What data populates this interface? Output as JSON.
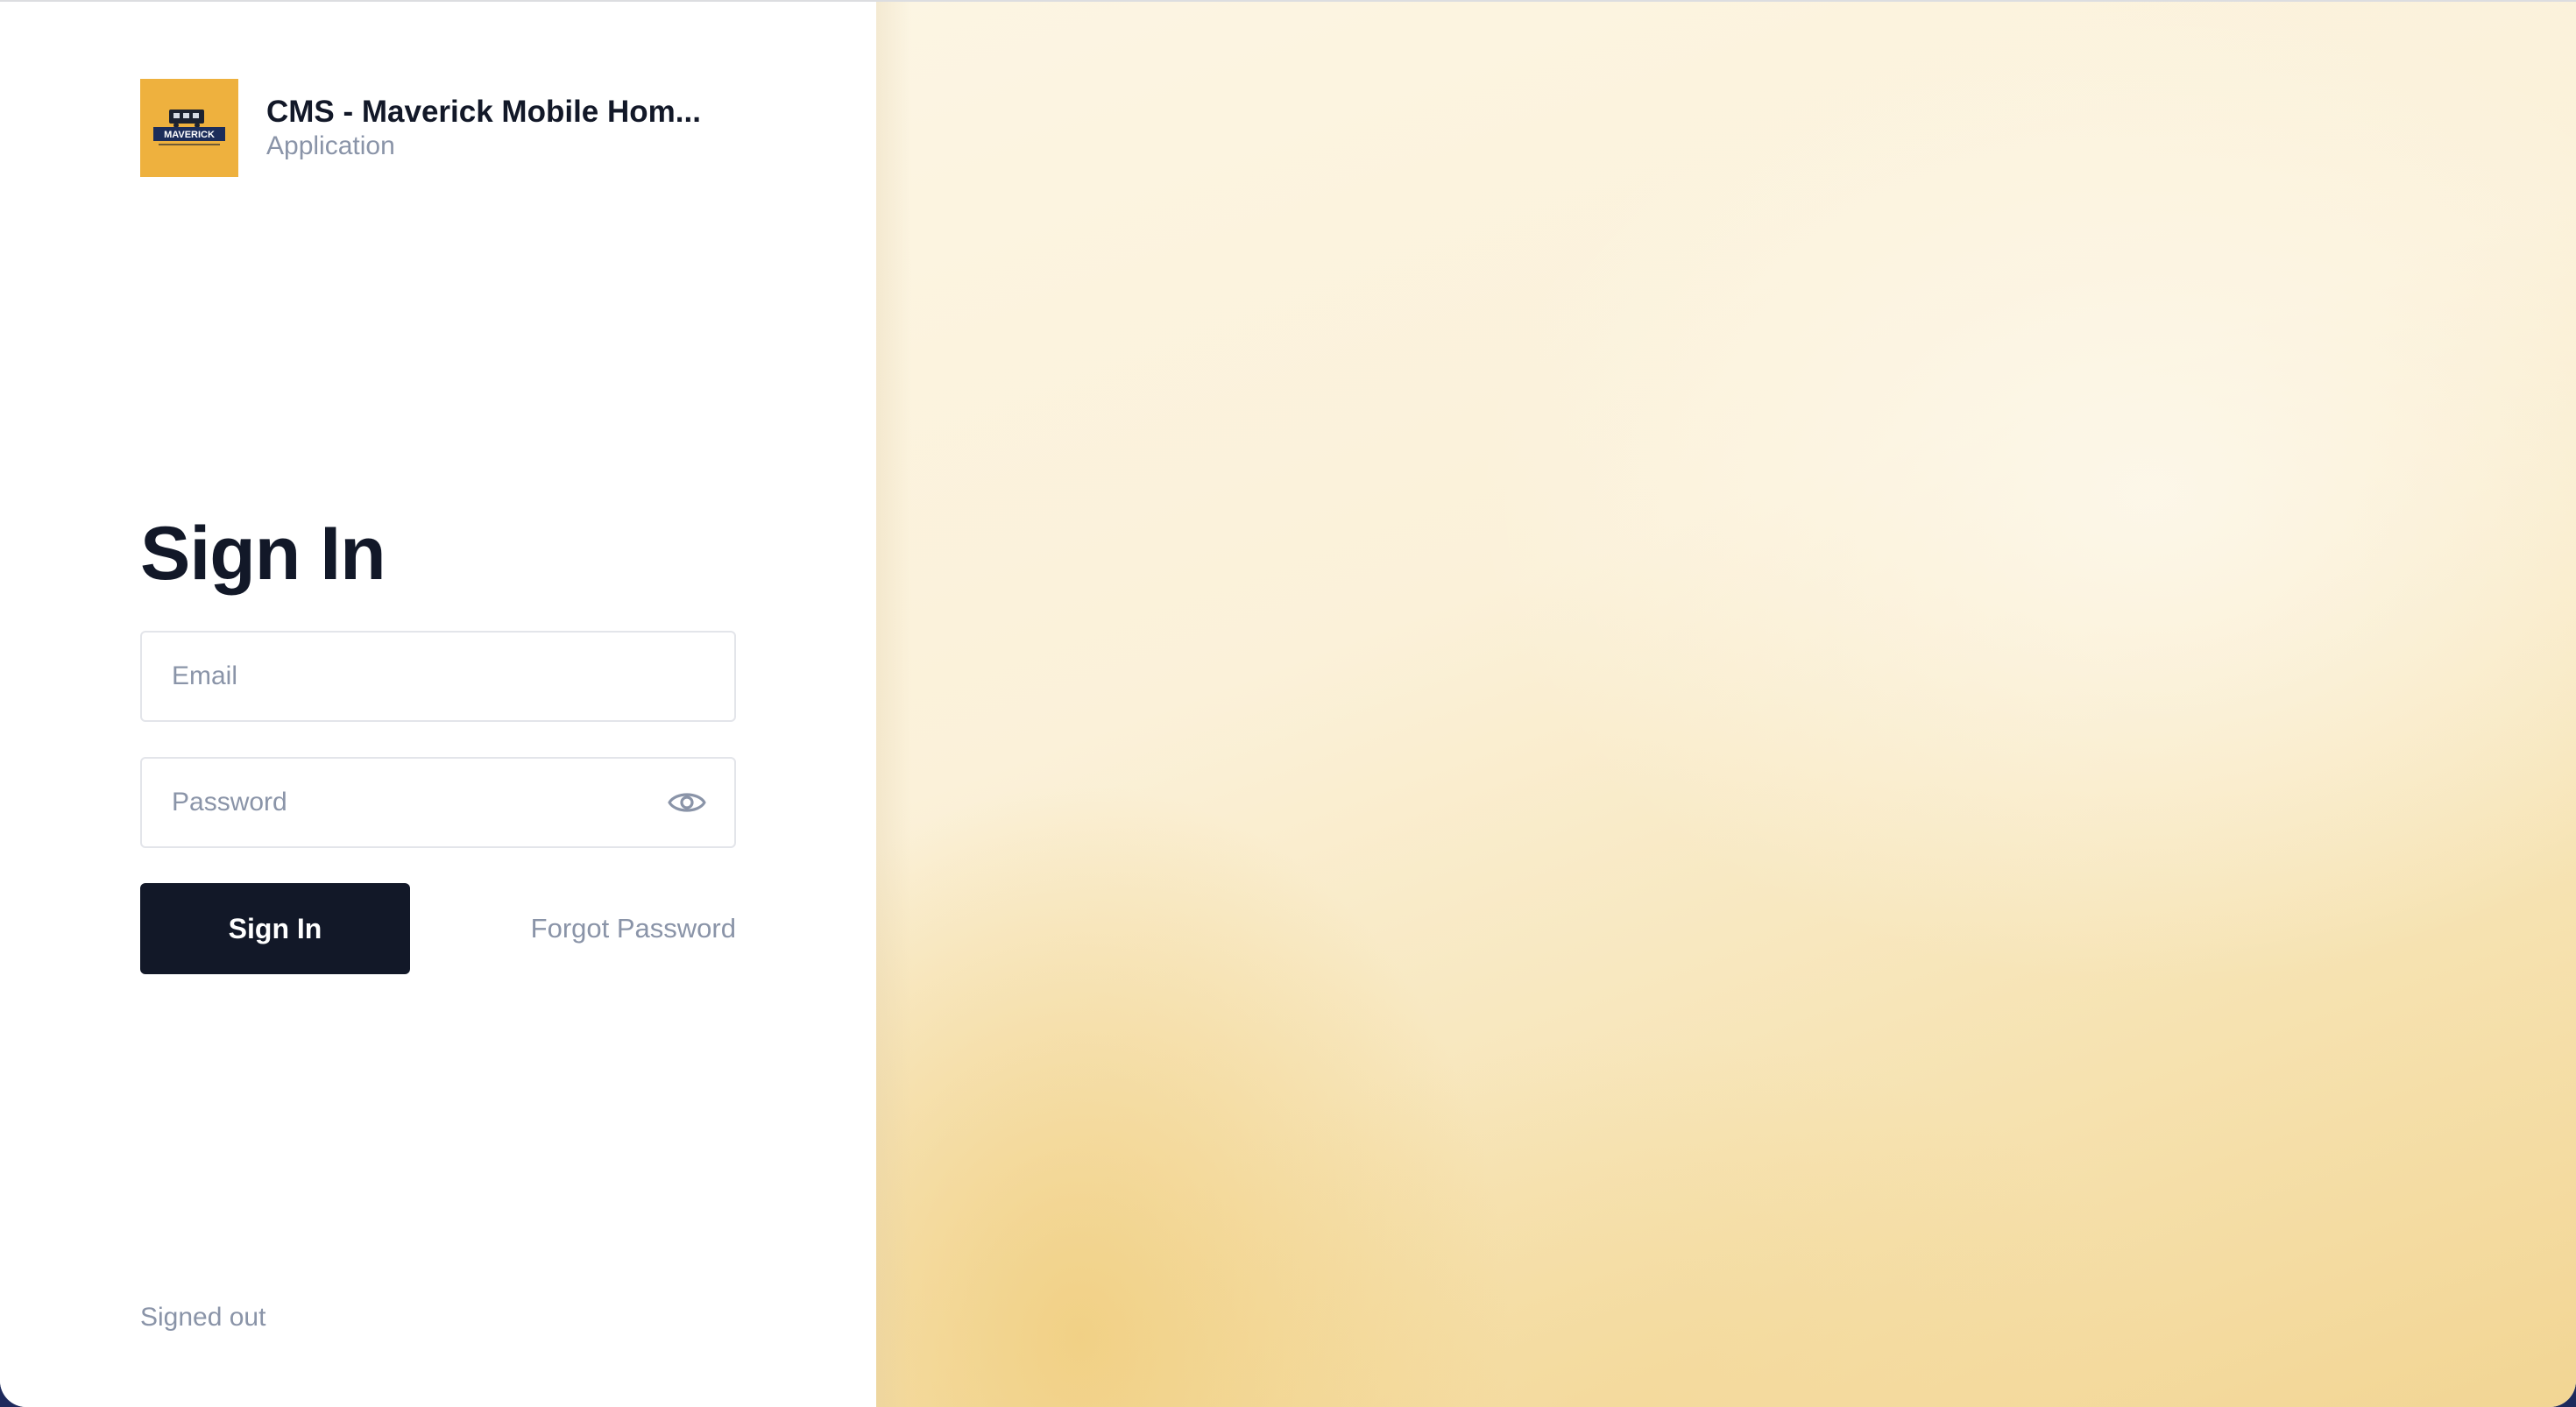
{
  "brand": {
    "title": "CMS - Maverick Mobile Hom...",
    "subtitle": "Application",
    "logo_text": "MAVERICK",
    "logo_bg": "#eeb13e"
  },
  "form": {
    "heading": "Sign In",
    "email_placeholder": "Email",
    "password_placeholder": "Password",
    "submit_label": "Sign In",
    "forgot_label": "Forgot Password",
    "show_password_icon": "eye-icon"
  },
  "footer": {
    "status": "Signed out"
  },
  "colors": {
    "primary": "#121828",
    "muted": "#8a94a8",
    "accent": "#eeb13e"
  }
}
